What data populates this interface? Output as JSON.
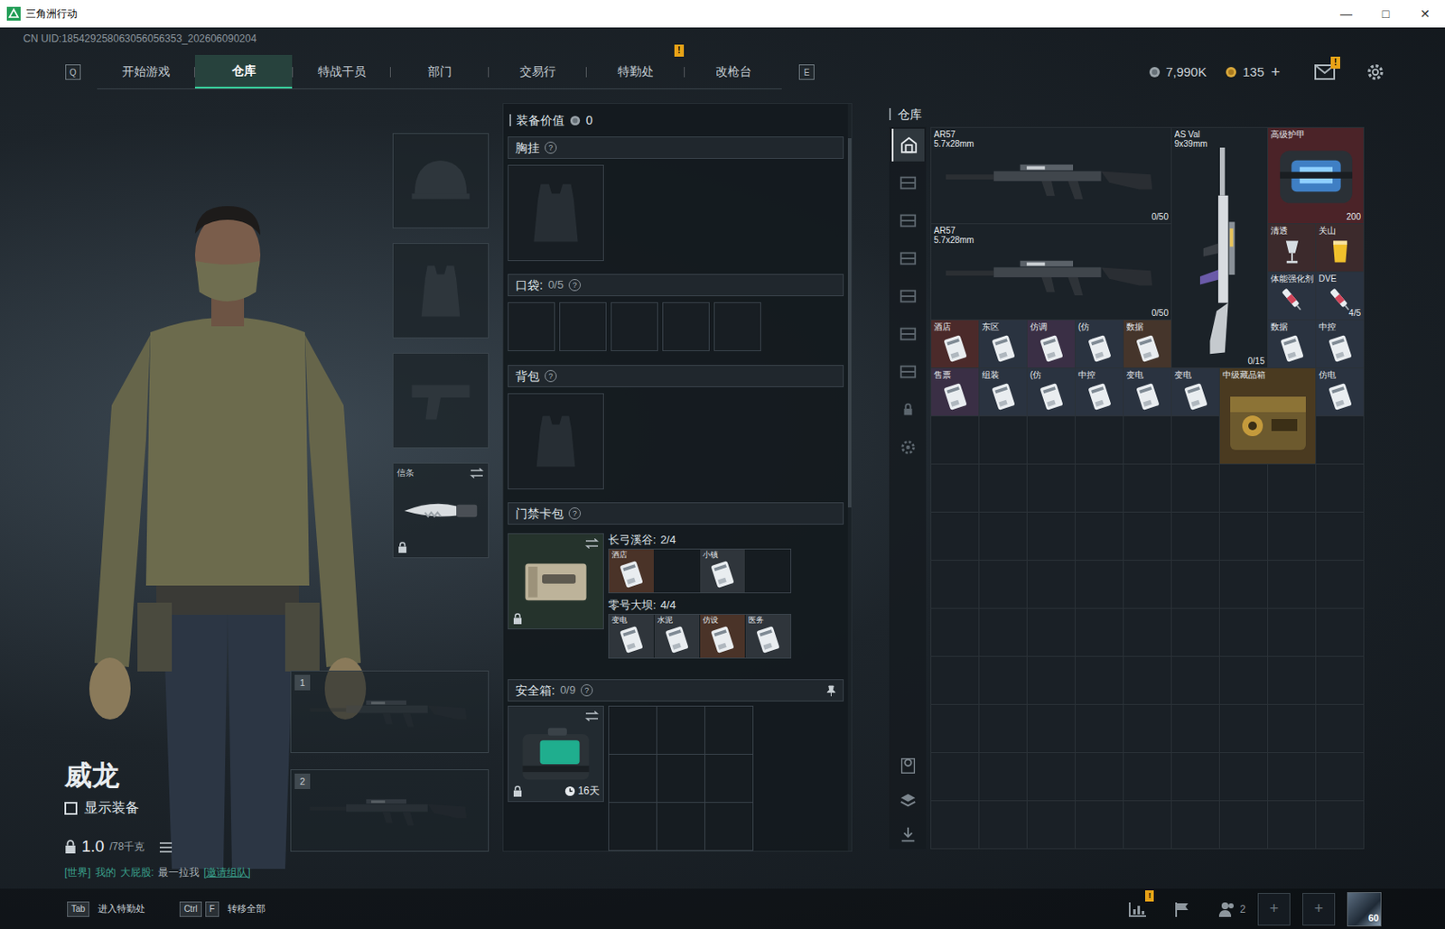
{
  "window": {
    "title": "三角洲行动",
    "controls": [
      "—",
      "□",
      "✕"
    ]
  },
  "uid": "CN UID:185429258063056056353_202606090204",
  "nav": {
    "prev_key": "Q",
    "next_key": "E",
    "tabs": [
      {
        "label": "开始游戏",
        "selected": false
      },
      {
        "label": "仓库",
        "selected": true
      },
      {
        "label": "特战干员",
        "selected": false
      },
      {
        "label": "部门",
        "selected": false
      },
      {
        "label": "交易行",
        "selected": false
      },
      {
        "label": "特勤处",
        "selected": false,
        "badge": "!"
      },
      {
        "label": "改枪台",
        "selected": false
      }
    ]
  },
  "currency": {
    "coins": "7,990K",
    "gold": "135",
    "add": "+",
    "mail_badge": "!"
  },
  "operator": {
    "name": "威龙",
    "show_gear": {
      "label": "显示装备",
      "checked": false
    },
    "weight": "1.0",
    "weight_max": "/78千克",
    "chat": {
      "channel": "[世界]",
      "sender_prefix": "我的",
      "sender": "大屁股:",
      "message": "最一拉我",
      "action": "[邀请组队]"
    }
  },
  "equipment": {
    "slots": [
      {
        "kind": "helmet"
      },
      {
        "kind": "armor"
      },
      {
        "kind": "pistol"
      },
      {
        "kind": "melee",
        "label": "信条",
        "locked": true
      }
    ],
    "weapons": [
      {
        "number": "1"
      },
      {
        "number": "2"
      }
    ]
  },
  "loadout": {
    "value_label": "装备价值",
    "value": "0",
    "chest": {
      "title": "胸挂",
      "help": "?"
    },
    "pockets": {
      "title": "口袋:",
      "count": "0/5",
      "help": "?",
      "slots": 5
    },
    "backpack": {
      "title": "背包",
      "help": "?"
    },
    "keycards": {
      "title": "门禁卡包",
      "help": "?",
      "locked": true,
      "maps": [
        {
          "name": "长弓溪谷:",
          "count": "2/4",
          "cards": [
            {
              "label": "酒店",
              "filled": true,
              "color": "#4a3328"
            },
            {
              "label": "",
              "filled": false,
              "color": "#161c21"
            },
            {
              "label": "小镇",
              "filled": true,
              "color": "#2f353b"
            },
            {
              "label": "",
              "filled": false,
              "color": "#161c21"
            }
          ]
        },
        {
          "name": "零号大坝:",
          "count": "4/4",
          "cards": [
            {
              "label": "变电",
              "filled": true,
              "color": "#2f353b"
            },
            {
              "label": "水泥",
              "filled": true,
              "color": "#2f353b"
            },
            {
              "label": "仿设",
              "filled": true,
              "color": "#4a3328"
            },
            {
              "label": "医务",
              "filled": true,
              "color": "#2f353b"
            }
          ]
        }
      ]
    },
    "safebox": {
      "title": "安全箱:",
      "count": "0/9",
      "help": "?",
      "days": "16天",
      "locked": true,
      "slots": 9
    }
  },
  "warehouse": {
    "title": "仓库",
    "tabs": [
      {
        "kind": "home",
        "selected": true
      },
      {
        "kind": "shelf",
        "selected": false
      },
      {
        "kind": "shelf",
        "selected": false
      },
      {
        "kind": "shelf",
        "selected": false
      },
      {
        "kind": "shelf",
        "selected": false
      },
      {
        "kind": "shelf",
        "selected": false
      },
      {
        "kind": "shelf",
        "selected": false
      },
      {
        "kind": "lock",
        "selected": false
      },
      {
        "kind": "settings",
        "selected": false
      }
    ],
    "items": [
      {
        "kind": "rifle",
        "name": "AR57",
        "sub": "5.7x28mm",
        "count": "0/50",
        "color": "#1b2228"
      },
      {
        "kind": "tall-rifle",
        "name": "AS Val",
        "sub": "9x39mm",
        "count": "0/15",
        "color": "#1b2228"
      },
      {
        "kind": "armor",
        "name": "高级护甲",
        "count": "200",
        "color": "#4b2328"
      },
      {
        "kind": "rifle",
        "name": "AR57",
        "sub": "5.7x28mm",
        "count": "0/50",
        "color": "#1b2228"
      },
      {
        "kind": "drink",
        "name": "清透",
        "color": "#3c2a2c"
      },
      {
        "kind": "drink",
        "name": "关山",
        "color": "#3c2a2c"
      },
      {
        "kind": "syringe",
        "name": "体能强化剂",
        "color": "#2a3340"
      },
      {
        "kind": "syringe",
        "name": "DVE",
        "count": "4/5",
        "color": "#2a3340"
      },
      {
        "kind": "key",
        "name": "酒店",
        "color": "#4b2a2a"
      },
      {
        "kind": "key",
        "name": "东区",
        "color": "#2a3340"
      },
      {
        "kind": "key",
        "name": "仿调",
        "color": "#3a2f45"
      },
      {
        "kind": "key",
        "name": "(仿",
        "color": "#2a3340"
      },
      {
        "kind": "key",
        "name": "数据",
        "color": "#45352b"
      },
      {
        "kind": "key",
        "name": "数据",
        "color": "#2a3340"
      },
      {
        "kind": "key",
        "name": "中控",
        "color": "#2a3340"
      },
      {
        "kind": "key",
        "name": "售票",
        "color": "#3a2f45"
      },
      {
        "kind": "key",
        "name": "组装",
        "color": "#2a3340"
      },
      {
        "kind": "key",
        "name": "(仿",
        "color": "#2a3340"
      },
      {
        "kind": "key",
        "name": "中控",
        "color": "#2a3340"
      },
      {
        "kind": "key",
        "name": "变电",
        "color": "#2a3340"
      },
      {
        "kind": "key",
        "name": "变电",
        "color": "#2a3340"
      },
      {
        "kind": "case",
        "name": "中级藏品箱",
        "color": "#4a3a20"
      },
      {
        "kind": "key",
        "name": "仿电",
        "color": "#2a3340"
      }
    ]
  },
  "bottom_bar": {
    "hints": [
      {
        "keys": [
          "Tab"
        ],
        "label": "进入特勤处"
      },
      {
        "keys": [
          "Ctrl",
          "F"
        ],
        "label": "转移全部"
      }
    ],
    "stats_badge": "!",
    "friends": "2",
    "party_slots": [
      "+",
      "+"
    ],
    "level": "60"
  }
}
